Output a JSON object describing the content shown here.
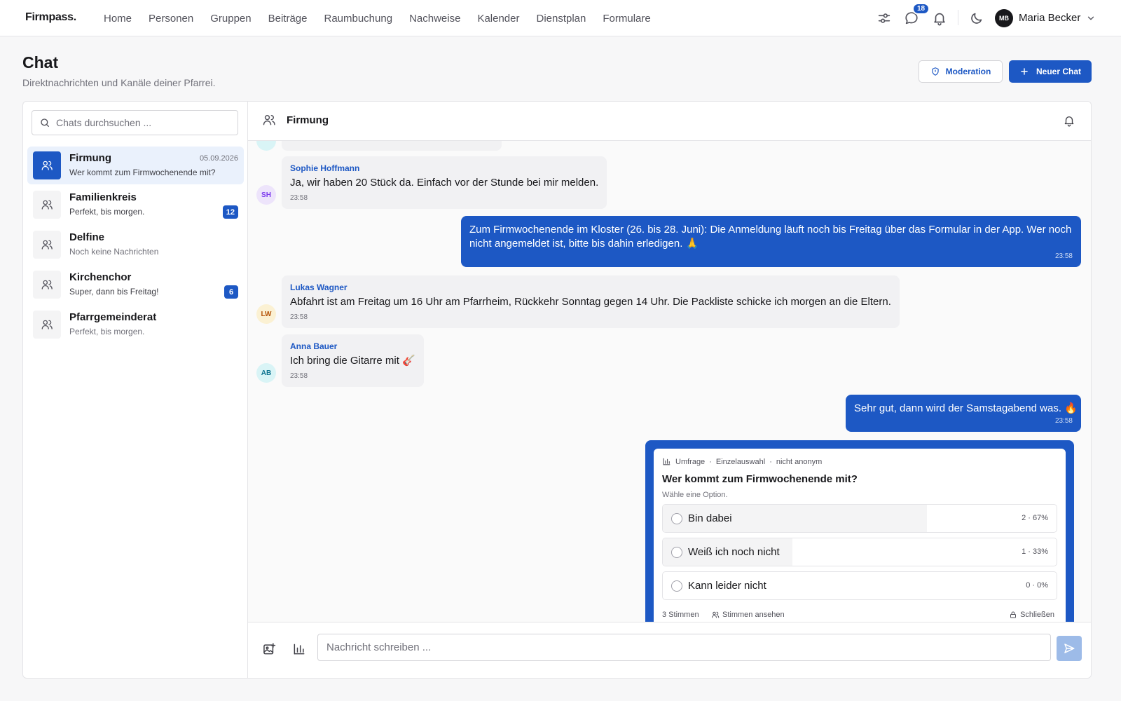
{
  "app": {
    "logo": "Firmpass."
  },
  "nav": [
    {
      "label": "Home"
    },
    {
      "label": "Personen"
    },
    {
      "label": "Gruppen"
    },
    {
      "label": "Beiträge"
    },
    {
      "label": "Raumbuchung"
    },
    {
      "label": "Nachweise"
    },
    {
      "label": "Kalender"
    },
    {
      "label": "Dienstplan"
    },
    {
      "label": "Formulare"
    }
  ],
  "topbar": {
    "chat_badge": "18",
    "user_initials": "MB",
    "user_name": "Maria Becker",
    "icons": [
      "sliders-icon",
      "message-icon",
      "bell-icon",
      "moon-icon",
      "chevron-down-icon"
    ]
  },
  "page": {
    "title": "Chat",
    "subtitle": "Direktnachrichten und Kanäle deiner Pfarrei.",
    "moderation_label": "Moderation",
    "new_chat_label": "Neuer Chat"
  },
  "sidebar": {
    "search_placeholder": "Chats durchsuchen ...",
    "chats": [
      {
        "name": "Firmung",
        "last": "Wer kommt zum Firmwochenende mit?",
        "date": "05.09.2026",
        "badge": "",
        "active": true
      },
      {
        "name": "Familienkreis",
        "last": "Perfekt, bis morgen.",
        "date": "",
        "badge": "12"
      },
      {
        "name": "Delfine",
        "last": "Noch keine Nachrichten",
        "date": "",
        "badge": ""
      },
      {
        "name": "Kirchenchor",
        "last": "Super, dann bis Freitag!",
        "date": "",
        "badge": "6"
      },
      {
        "name": "Pfarrgemeinderat",
        "last": "Perfekt, bis morgen.",
        "date": "",
        "badge": ""
      }
    ]
  },
  "conversation": {
    "title": "Firmung",
    "messages": [
      {
        "initials": "SH",
        "sender": "Sophie Hoffmann",
        "text": "Ja, wir haben 20 Stück da. Einfach vor der Stunde bei mir melden.",
        "time": "23:58"
      },
      {
        "own": true,
        "text": "Zum Firmwochenende im Kloster (26. bis 28. Juni): Die Anmeldung läuft noch bis Freitag über das Formular in der App. Wer noch nicht angemeldet ist, bitte bis dahin erledigen. 🙏",
        "time": "23:58"
      },
      {
        "initials": "LW",
        "sender": "Lukas Wagner",
        "text": "Abfahrt ist am Freitag um 16 Uhr am Pfarrheim, Rückkehr Sonntag gegen 14 Uhr. Die Packliste schicke ich morgen an die Eltern.",
        "time": "23:58"
      },
      {
        "initials": "AB",
        "sender": "Anna Bauer",
        "text": "Ich bring die Gitarre mit 🎸",
        "time": "23:58"
      },
      {
        "own": true,
        "text": "Sehr gut, dann wird der Samstagabend was. 🔥",
        "time": "23:58"
      }
    ],
    "poll": {
      "type_label": "Umfrage",
      "mode_label": "Einzelauswahl",
      "anon_label": "nicht anonym",
      "question": "Wer kommt zum Firmwochenende mit?",
      "hint": "Wähle eine Option.",
      "options": [
        {
          "label": "Bin dabei",
          "count": "2 · 67%",
          "share": 0.67
        },
        {
          "label": "Weiß ich noch nicht",
          "count": "1 · 33%",
          "share": 0.33
        },
        {
          "label": "Kann leider nicht",
          "count": "0 · 0%",
          "share": 0
        }
      ],
      "votes": "3 Stimmen",
      "see_votes": "Stimmen ansehen",
      "close_label": "Schließen"
    },
    "composer_placeholder": "Nachricht schreiben ..."
  },
  "colors": {
    "accent": "#1d58c4",
    "sh_avatar": "#ede4fb",
    "lw_avatar": "#fbf1d3",
    "ab_avatar": "#d9f4f6"
  }
}
